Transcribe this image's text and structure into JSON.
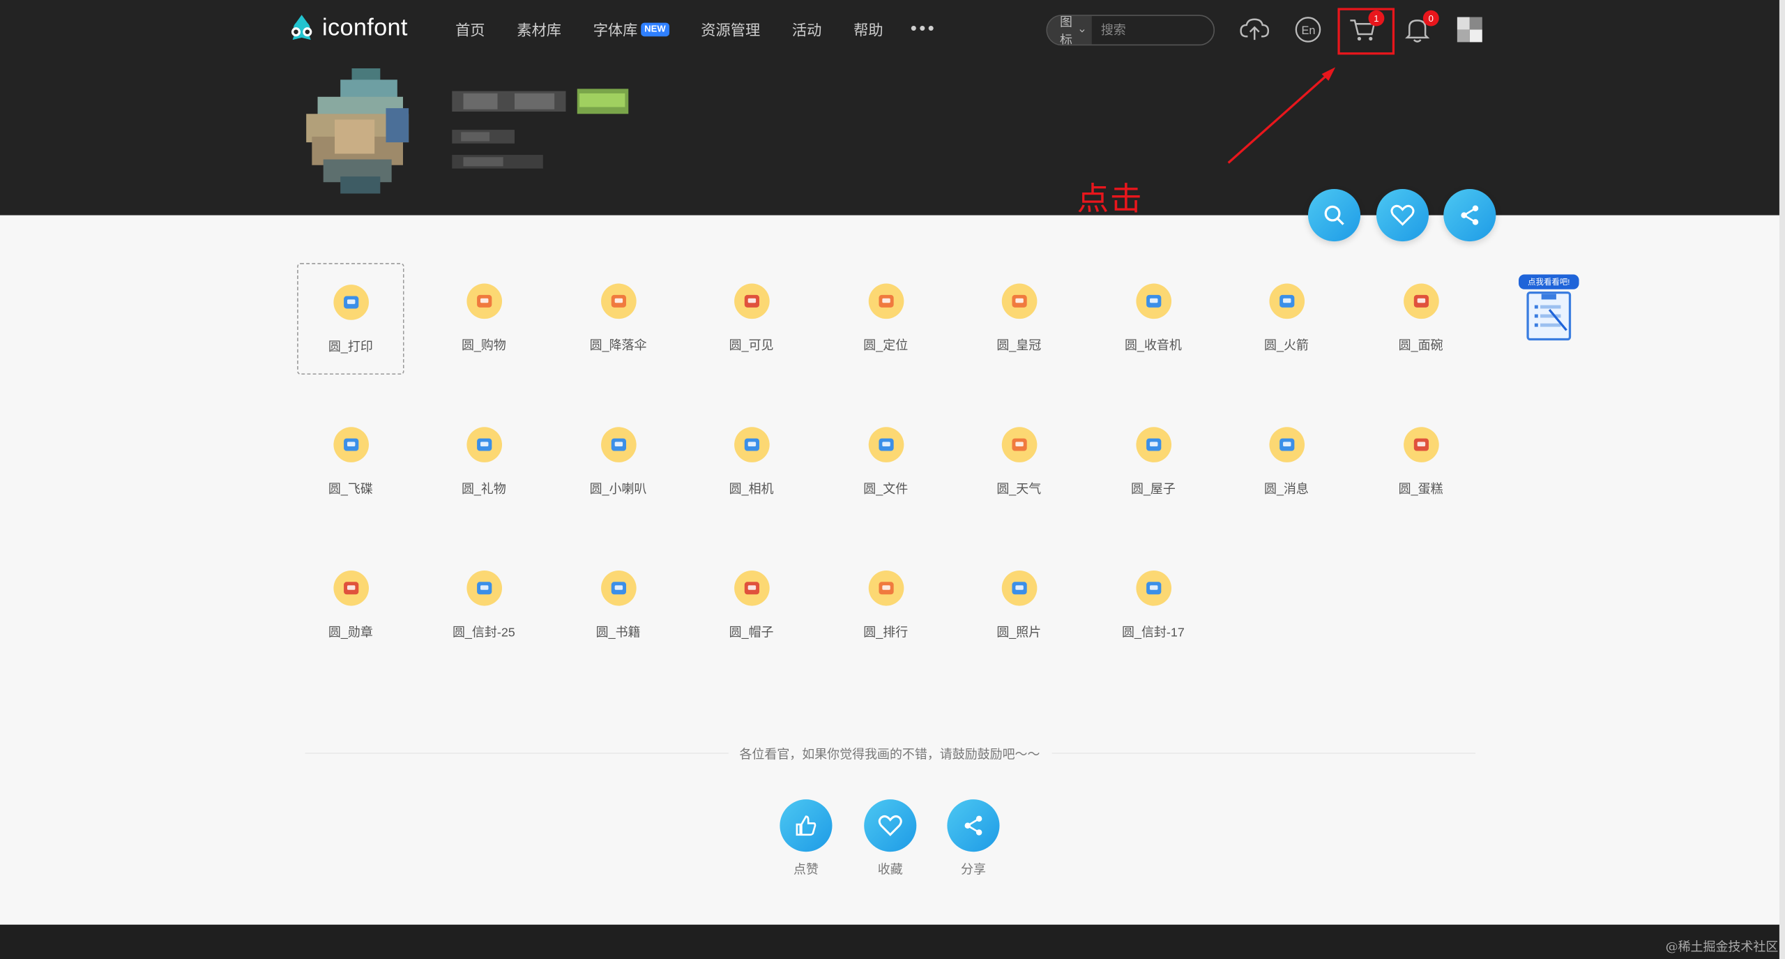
{
  "header": {
    "logo_text": "iconfont",
    "nav": [
      {
        "label": "首页"
      },
      {
        "label": "素材库"
      },
      {
        "label": "字体库",
        "badge": "NEW"
      },
      {
        "label": "资源管理"
      },
      {
        "label": "活动"
      },
      {
        "label": "帮助"
      }
    ],
    "more_label": "•••",
    "search": {
      "type_label": "图标",
      "placeholder": "搜索"
    },
    "cart_count": "1",
    "notification_count": "0"
  },
  "annotation": {
    "text": "点击"
  },
  "icons": [
    {
      "name": "圆_打印",
      "glyph": "print-icon",
      "color": "#3b8fe8",
      "selected": true
    },
    {
      "name": "圆_购物",
      "glyph": "shopping-bag-icon",
      "color": "#f07a3e"
    },
    {
      "name": "圆_降落伞",
      "glyph": "parachute-icon",
      "color": "#f07a3e"
    },
    {
      "name": "圆_可见",
      "glyph": "eye-icon",
      "color": "#e0523c"
    },
    {
      "name": "圆_定位",
      "glyph": "location-pin-icon",
      "color": "#f07a3e"
    },
    {
      "name": "圆_皇冠",
      "glyph": "crown-icon",
      "color": "#f07a3e"
    },
    {
      "name": "圆_收音机",
      "glyph": "radio-icon",
      "color": "#3b8fe8"
    },
    {
      "name": "圆_火箭",
      "glyph": "rocket-icon",
      "color": "#3b8fe8"
    },
    {
      "name": "圆_面碗",
      "glyph": "noodle-bowl-icon",
      "color": "#e0523c"
    },
    {
      "name": "圆_飞碟",
      "glyph": "ufo-icon",
      "color": "#3b8fe8"
    },
    {
      "name": "圆_礼物",
      "glyph": "gift-icon",
      "color": "#3b8fe8"
    },
    {
      "name": "圆_小喇叭",
      "glyph": "megaphone-icon",
      "color": "#3b8fe8"
    },
    {
      "name": "圆_相机",
      "glyph": "camera-icon",
      "color": "#3b8fe8"
    },
    {
      "name": "圆_文件",
      "glyph": "folder-icon",
      "color": "#3b8fe8"
    },
    {
      "name": "圆_天气",
      "glyph": "weather-icon",
      "color": "#f07a3e"
    },
    {
      "name": "圆_屋子",
      "glyph": "house-icon",
      "color": "#3b8fe8"
    },
    {
      "name": "圆_消息",
      "glyph": "bell-icon",
      "color": "#3b8fe8"
    },
    {
      "name": "圆_蛋糕",
      "glyph": "cake-icon",
      "color": "#e0523c"
    },
    {
      "name": "圆_勋章",
      "glyph": "medal-icon",
      "color": "#e0523c"
    },
    {
      "name": "圆_信封-25",
      "glyph": "envelope-icon",
      "color": "#3b8fe8"
    },
    {
      "name": "圆_书籍",
      "glyph": "book-icon",
      "color": "#3b8fe8"
    },
    {
      "name": "圆_帽子",
      "glyph": "hat-icon",
      "color": "#e0523c"
    },
    {
      "name": "圆_排行",
      "glyph": "ranking-icon",
      "color": "#f07a3e"
    },
    {
      "name": "圆_照片",
      "glyph": "photo-icon",
      "color": "#3b8fe8"
    },
    {
      "name": "圆_信封-17",
      "glyph": "envelope-icon",
      "color": "#3b8fe8"
    }
  ],
  "side_widget": {
    "label": "点我看看吧!"
  },
  "footer": {
    "message": "各位看官，如果你觉得我画的不错，请鼓励鼓励吧～～",
    "actions": [
      {
        "label": "点赞",
        "icon": "thumbs-up-icon"
      },
      {
        "label": "收藏",
        "icon": "heart-icon"
      },
      {
        "label": "分享",
        "icon": "share-icon"
      }
    ]
  },
  "watermark": "@稀土掘金技术社区",
  "colors": {
    "accent": "#1e9be6",
    "header_bg": "#232323",
    "highlight": "#e8161c",
    "icon_circle": "#fcd873"
  }
}
